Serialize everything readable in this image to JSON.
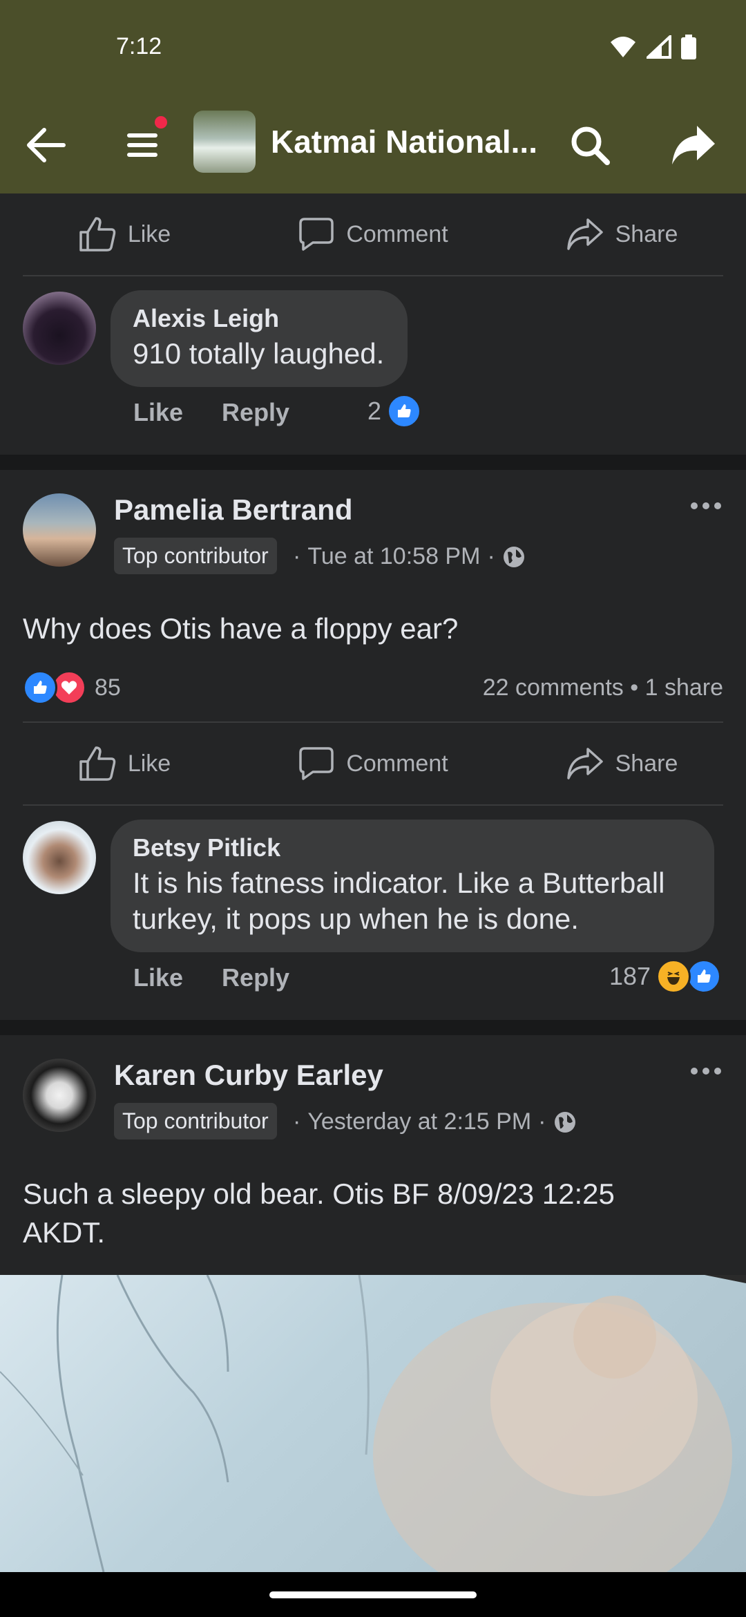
{
  "status_bar": {
    "time": "7:12"
  },
  "app_bar": {
    "title": "Katmai National..."
  },
  "action_labels": {
    "like": "Like",
    "comment": "Comment",
    "share": "Share"
  },
  "comment_actions": {
    "like": "Like",
    "reply": "Reply"
  },
  "comments": [
    {
      "author": "Alexis Leigh",
      "text": "910 totally laughed.",
      "reaction_count": "2"
    },
    {
      "author": "Betsy Pitlick",
      "text": "It is his fatness indicator. Like a Butterball turkey, it pops up when he is done.",
      "reaction_count": "187"
    }
  ],
  "posts": [
    {
      "author": "Pamelia Bertrand",
      "badge": "Top contributor",
      "timestamp": "Tue at 10:58 PM",
      "text": "Why does Otis have a floppy ear?",
      "reaction_count": "85",
      "engagement": "22 comments • 1 share"
    },
    {
      "author": "Karen Curby Earley",
      "badge": "Top contributor",
      "timestamp": "Yesterday at 2:15 PM",
      "text": "Such a sleepy old bear.  Otis BF 8/09/23 12:25 AKDT."
    }
  ],
  "colors": {
    "appbar": "#4b4f2a",
    "background": "#242526",
    "like_blue": "#2d88ff",
    "love_red": "#f33e58",
    "haha_yellow": "#f7b125"
  }
}
